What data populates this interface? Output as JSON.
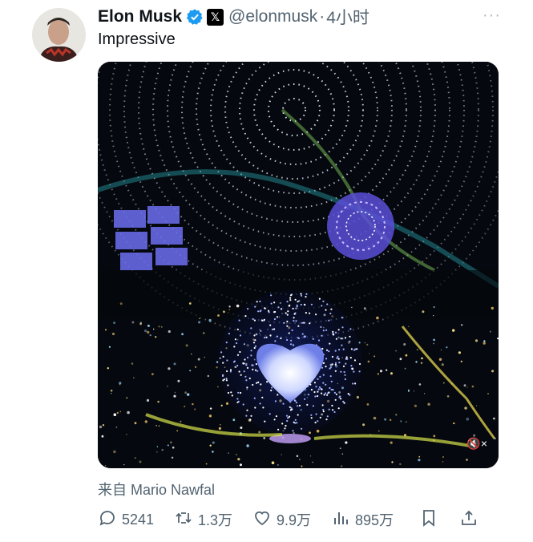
{
  "tweet": {
    "author_name": "Elon Musk",
    "x_badge": "𝕏",
    "handle": "@elonmusk",
    "separator": "·",
    "time": "4小时",
    "more": "···",
    "text": "Impressive",
    "source": "来自 Mario Nawfal"
  },
  "media": {
    "mute_label": "🔇×"
  },
  "actions": {
    "replies": "5241",
    "retweets": "1.3万",
    "likes": "9.9万",
    "views": "895万"
  },
  "colors": {
    "verified": "#1d9bf0",
    "muted_text": "#536471",
    "primary_text": "#0f1419"
  },
  "icons": [
    "verified-icon",
    "reply-icon",
    "retweet-icon",
    "like-icon",
    "views-icon",
    "bookmark-icon",
    "share-icon",
    "mute-icon"
  ]
}
